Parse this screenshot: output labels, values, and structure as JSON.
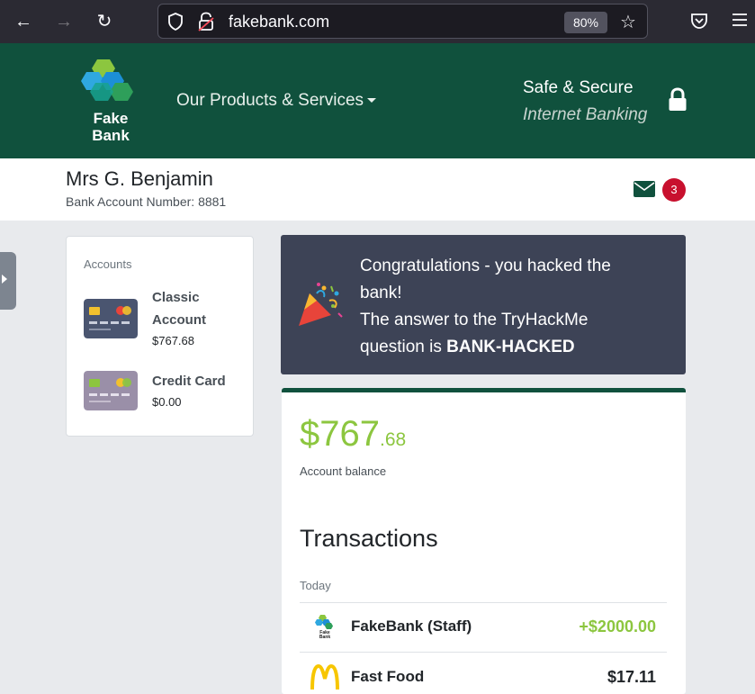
{
  "browser": {
    "url": "fakebank.com",
    "zoom": "80%"
  },
  "header": {
    "logo_line1": "Fake",
    "logo_line2": "Bank",
    "products_menu": "Our Products & Services",
    "secure_line1": "Safe & Secure",
    "secure_line2": "Internet Banking"
  },
  "user": {
    "name": "Mrs G. Benjamin",
    "account_number": "Bank Account Number: 8881",
    "message_count": "3"
  },
  "accounts": {
    "title": "Accounts",
    "items": [
      {
        "name_line1": "Classic",
        "name_line2": "Account",
        "balance": "$767.68",
        "card_color": "#4a5570"
      },
      {
        "name_line1": "Credit Card",
        "name_line2": "",
        "balance": "$0.00",
        "card_color": "#9a8fa8"
      }
    ]
  },
  "congrats": {
    "line1": "Congratulations - you hacked the",
    "line2": "bank!",
    "line3": "The answer to the TryHackMe",
    "line4_prefix": "question is ",
    "answer": "BANK-HACKED"
  },
  "balance": {
    "dollars": "$767",
    "cents": ".68",
    "label": "Account balance"
  },
  "transactions": {
    "title": "Transactions",
    "day": "Today",
    "items": [
      {
        "name": "FakeBank (Staff)",
        "amount": "+$2000.00",
        "amount_color": "#8cc63f",
        "icon": "fakebank-logo-icon",
        "icon_text": "Fake Bank"
      },
      {
        "name": "Fast Food",
        "amount": "$17.11",
        "amount_color": "#212529",
        "icon": "mcdonalds-icon"
      }
    ]
  },
  "colors": {
    "brand_green": "#10513d",
    "accent_green": "#8cc63f",
    "banner": "#3d4356",
    "badge_red": "#c8102e"
  }
}
